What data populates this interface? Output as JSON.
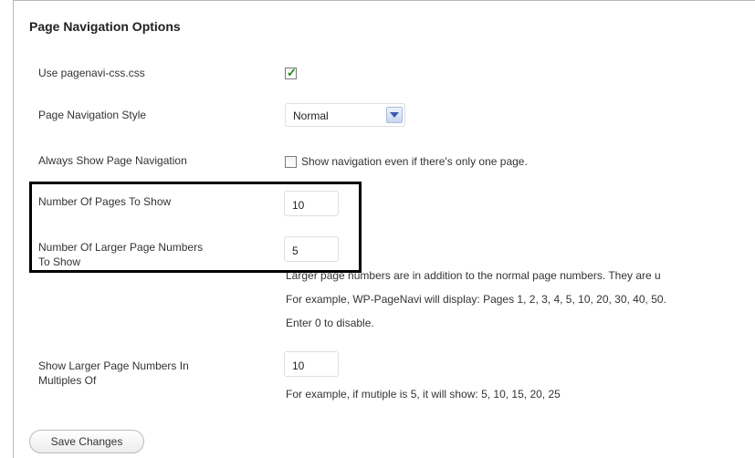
{
  "title": "Page Navigation Options",
  "fields": {
    "use_css": {
      "label": "Use pagenavi-css.css",
      "checked": true
    },
    "style": {
      "label": "Page Navigation Style",
      "value": "Normal"
    },
    "always_show": {
      "label": "Always Show Page Navigation",
      "checked": false,
      "checkbox_text": "Show navigation even if there's only one page."
    },
    "num_pages": {
      "label": "Number Of Pages To Show",
      "value": "10"
    },
    "num_larger": {
      "label_line1": "Number Of Larger Page Numbers",
      "label_line2": "To Show",
      "value": "5",
      "desc1": "Larger page numbers are in addition to the normal page numbers. They are u",
      "desc2": "For example, WP-PageNavi will display: Pages 1, 2, 3, 4, 5, 10, 20, 30, 40, 50.",
      "desc3": "Enter 0 to disable."
    },
    "multiples": {
      "label_line1": "Show Larger Page Numbers In",
      "label_line2": "Multiples Of",
      "value": "10",
      "desc": "For example, if mutiple is 5, it will show: 5, 10, 15, 20, 25"
    }
  },
  "save_label": "Save Changes",
  "colors": {
    "check": "#1a8f1a",
    "dropdown_arrow": "#3a5da8",
    "highlight_border": "#000000"
  },
  "icons": {
    "checkmark": "✓"
  }
}
